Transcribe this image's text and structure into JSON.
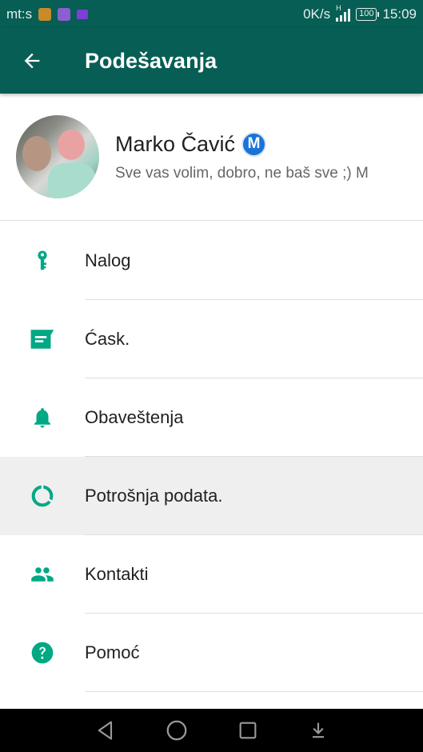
{
  "status_bar": {
    "carrier": "mt:s",
    "speed": "0K/s",
    "network_type": "H",
    "battery": "100",
    "time": "15:09"
  },
  "toolbar": {
    "title": "Podešavanja",
    "back_icon": "arrow-left-icon"
  },
  "profile": {
    "name": "Marko Čavić",
    "badge": "M",
    "status": "Sve vas volim, dobro, ne baš sve ;) M"
  },
  "menu": {
    "items": [
      {
        "label": "Nalog",
        "icon": "key-icon"
      },
      {
        "label": "Ćask.",
        "icon": "chat-icon"
      },
      {
        "label": "Obaveštenja",
        "icon": "bell-icon"
      },
      {
        "label": "Potrošnja podata.",
        "icon": "data-usage-icon",
        "active": true
      },
      {
        "label": "Kontakti",
        "icon": "contacts-icon"
      },
      {
        "label": "Pomoć",
        "icon": "help-icon"
      }
    ]
  },
  "colors": {
    "primary": "#075e54",
    "icon_teal": "#00a884",
    "active_row": "#efefef"
  }
}
